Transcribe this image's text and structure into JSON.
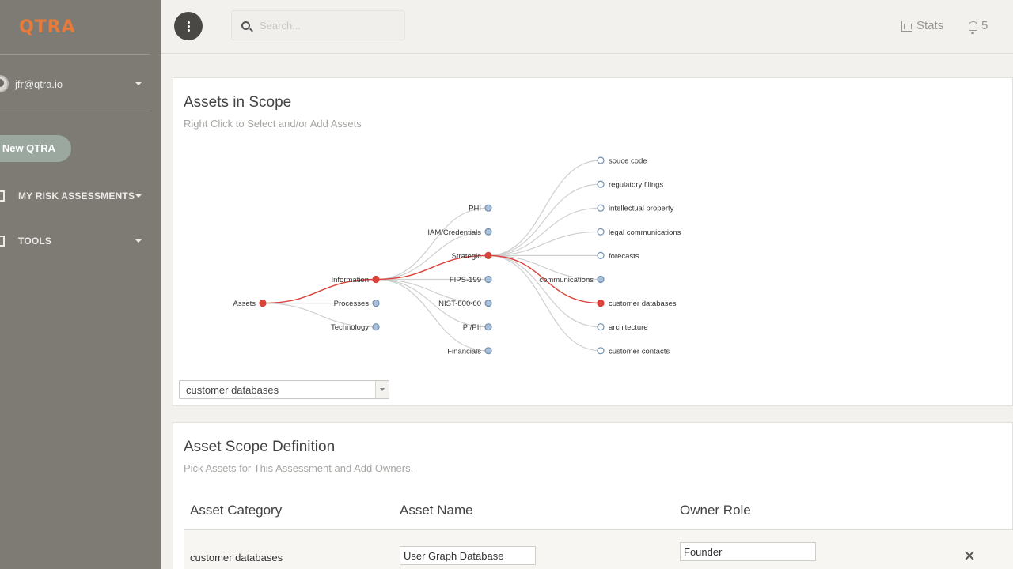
{
  "sidebar": {
    "logo": "QTRA",
    "user_email": "jfr@qtra.io",
    "new_button": "New QTRA",
    "nav": [
      {
        "label": "MY RISK ASSESSMENTS"
      },
      {
        "label": "TOOLS"
      }
    ]
  },
  "topbar": {
    "search_placeholder": "Search...",
    "stats_label": "Stats",
    "notification_count": "5"
  },
  "assets_card": {
    "title": "Assets in Scope",
    "subtitle": "Right Click to Select and/or Add Assets",
    "tree": {
      "root": "Assets",
      "nodes": [
        {
          "id": "assets",
          "label": "Assets",
          "level": 0,
          "row": 6,
          "selected": true,
          "parent": null
        },
        {
          "id": "information",
          "label": "Information",
          "level": 1,
          "row": 5,
          "selected": true,
          "parent": "assets"
        },
        {
          "id": "processes",
          "label": "Processes",
          "level": 1,
          "row": 6,
          "selected": false,
          "parent": "assets"
        },
        {
          "id": "technology",
          "label": "Technology",
          "level": 1,
          "row": 7,
          "selected": false,
          "parent": "assets"
        },
        {
          "id": "phi",
          "label": "PHI",
          "level": 2,
          "row": 2,
          "selected": false,
          "parent": "information"
        },
        {
          "id": "iam",
          "label": "IAM/Credentials",
          "level": 2,
          "row": 3,
          "selected": false,
          "parent": "information"
        },
        {
          "id": "strategic",
          "label": "Strategic",
          "level": 2,
          "row": 4,
          "selected": true,
          "parent": "information"
        },
        {
          "id": "fips",
          "label": "FIPS-199",
          "level": 2,
          "row": 5,
          "selected": false,
          "parent": "information"
        },
        {
          "id": "nist",
          "label": "NIST-800-60",
          "level": 2,
          "row": 6,
          "selected": false,
          "parent": "information"
        },
        {
          "id": "pii",
          "label": "PI/PII",
          "level": 2,
          "row": 7,
          "selected": false,
          "parent": "information"
        },
        {
          "id": "financials",
          "label": "Financials",
          "level": 2,
          "row": 8,
          "selected": false,
          "parent": "information"
        },
        {
          "id": "source",
          "label": "souce code",
          "level": 3,
          "row": 0,
          "selected": false,
          "parent": "strategic"
        },
        {
          "id": "regulatory",
          "label": "regulatory filings",
          "level": 3,
          "row": 1,
          "selected": false,
          "parent": "strategic"
        },
        {
          "id": "ip",
          "label": "intellectual property",
          "level": 3,
          "row": 2,
          "selected": false,
          "parent": "strategic"
        },
        {
          "id": "legal",
          "label": "legal communications",
          "level": 3,
          "row": 3,
          "selected": false,
          "parent": "strategic"
        },
        {
          "id": "forecasts",
          "label": "forecasts",
          "level": 3,
          "row": 4,
          "selected": false,
          "parent": "strategic"
        },
        {
          "id": "comms",
          "label": "communications",
          "level": 3,
          "row": 5,
          "selected": false,
          "parent": "strategic",
          "label_left": true
        },
        {
          "id": "custdb",
          "label": "customer databases",
          "level": 3,
          "row": 6,
          "selected": true,
          "parent": "strategic"
        },
        {
          "id": "arch",
          "label": "architecture",
          "level": 3,
          "row": 7,
          "selected": false,
          "parent": "strategic"
        },
        {
          "id": "contacts",
          "label": "customer contacts",
          "level": 3,
          "row": 8,
          "selected": false,
          "parent": "strategic"
        }
      ]
    },
    "selected_value": "customer databases"
  },
  "scope_card": {
    "title": "Asset Scope Definition",
    "subtitle": "Pick Assets for This Assessment and Add Owners.",
    "columns": [
      "Asset Category",
      "Asset Name",
      "Owner Role"
    ],
    "rows": [
      {
        "category": "customer databases",
        "name": "User Graph Database",
        "owner": "Founder"
      }
    ]
  },
  "colors": {
    "accent": "#e87a3c",
    "selected_node": "#d9423a",
    "unselected_node": "#a9c0d8",
    "sidebar_bg": "#7e7b75"
  }
}
